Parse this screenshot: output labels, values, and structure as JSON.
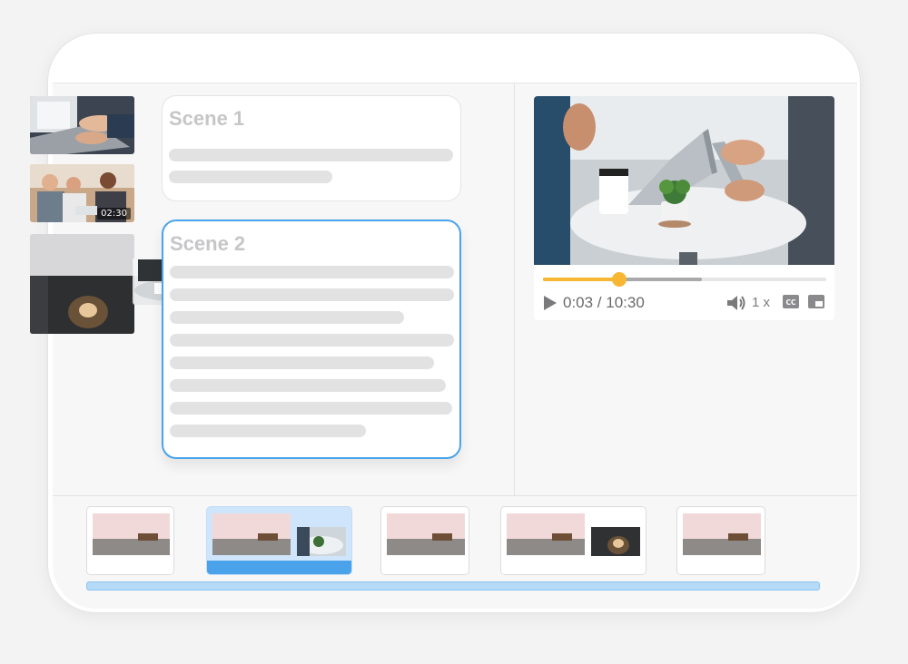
{
  "scenes": [
    {
      "title": "Scene 1"
    },
    {
      "title": "Scene 2"
    }
  ],
  "media_library": {
    "items": [
      {
        "subject": "hands typing on laptop"
      },
      {
        "subject": "people meeting",
        "duration": "02:30"
      },
      {
        "subject": "coffee on cafe table"
      }
    ]
  },
  "player": {
    "time_display": "0:03 / 10:30",
    "speed": "1 x",
    "progress": 0.27,
    "buffered": 0.56,
    "cc_label": "CC",
    "icons": {
      "play": "play-icon",
      "volume": "volume-icon",
      "captions": "cc-icon",
      "pip": "picture-in-picture-icon"
    }
  },
  "colors": {
    "accent": "#4aa3ea",
    "progress": "#f7b733",
    "cursor": "#f6863a"
  }
}
